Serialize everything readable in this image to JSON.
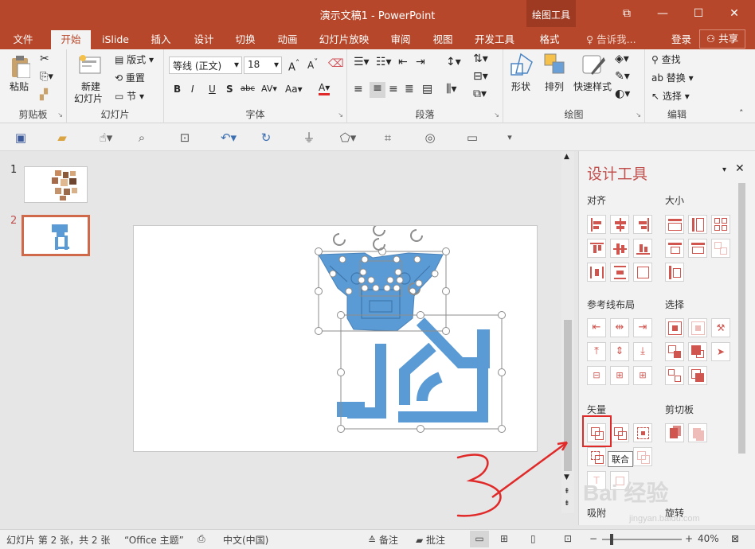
{
  "window": {
    "title": "演示文稿1 - PowerPoint",
    "context_tab_group": "绘图工具",
    "controls": [
      "restore-icon",
      "minimize-icon",
      "maximize-icon",
      "close-icon"
    ]
  },
  "tabs": [
    {
      "label": "文件"
    },
    {
      "label": "开始",
      "active": true
    },
    {
      "label": "iSlide"
    },
    {
      "label": "插入"
    },
    {
      "label": "设计"
    },
    {
      "label": "切换"
    },
    {
      "label": "动画"
    },
    {
      "label": "幻灯片放映"
    },
    {
      "label": "审阅"
    },
    {
      "label": "视图"
    },
    {
      "label": "开发工具"
    },
    {
      "label": "格式"
    }
  ],
  "tell_me": "告诉我...",
  "login": "登录",
  "share": "共享",
  "ribbon": {
    "clipboard": {
      "name": "剪贴板",
      "paste": "粘贴"
    },
    "slides": {
      "name": "幻灯片",
      "new_slide_l1": "新建",
      "new_slide_l2": "幻灯片",
      "layout": "版式",
      "reset": "重置",
      "section": "节"
    },
    "font": {
      "name": "字体",
      "font_family": "等线 (正文)",
      "font_size": "18",
      "bold": "B",
      "italic": "I",
      "underline": "U",
      "shadow": "S",
      "strike": "abc",
      "spacing": "AV",
      "case": "Aa",
      "color_a": "A"
    },
    "paragraph": {
      "name": "段落"
    },
    "drawing": {
      "name": "绘图",
      "shapes": "形状",
      "arrange": "排列",
      "quick_styles": "快速样式"
    },
    "editing": {
      "name": "编辑",
      "find": "查找",
      "replace": "替换",
      "select": "选择"
    }
  },
  "thumbnails": [
    {
      "num": "1"
    },
    {
      "num": "2",
      "selected": true
    }
  ],
  "design_pane": {
    "title": "设计工具",
    "sections": {
      "align": "对齐",
      "size": "大小",
      "guides": "参考线布局",
      "select": "选择",
      "vector": "矢量",
      "clip": "剪切板",
      "snap": "吸附",
      "rotate": "旋转"
    },
    "tooltip": "联合"
  },
  "status": {
    "slide_info": "幻灯片 第 2 张，共 2 张",
    "theme": "“Office 主题”",
    "language": "中文(中国)",
    "notes": "备注",
    "comments": "批注",
    "zoom": "40%"
  },
  "annotation": {
    "handwritten": "3"
  },
  "watermark": {
    "text": "Bai 经验",
    "url": "jingyan.baidu.com"
  },
  "colors": {
    "accent": "#b7472a",
    "shape": "#5b9bd5",
    "pane_icon": "#d0554f",
    "annotation": "#e02a2a"
  }
}
